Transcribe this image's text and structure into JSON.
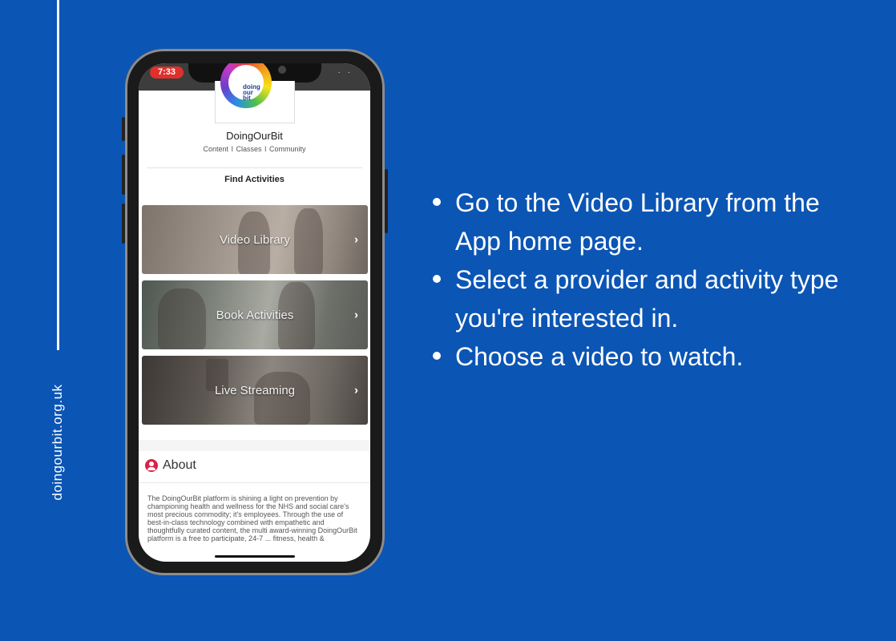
{
  "site_url": "doingourbit.org.uk",
  "phone": {
    "status_time": "7:33",
    "logo_text": [
      "doing",
      "our",
      "bit"
    ],
    "app_name": "DoingOurBit",
    "tagline": "Content  I  Classes  I  Community",
    "section_title": "Find Activities",
    "tiles": [
      {
        "label": "Video Library",
        "chevron": "›"
      },
      {
        "label": "Book Activities",
        "chevron": "›"
      },
      {
        "label": "Live Streaming",
        "chevron": "›"
      }
    ],
    "about": {
      "title": "About",
      "text": "The DoingOurBit platform is shining a light on prevention by championing health and wellness for the NHS and social care's most precious commodity; it's employees. Through the use of best-in-class technology combined with empathetic and thoughtfully curated content, the multi award-winning DoingOurBit platform is a free to participate, 24-7 ... fitness, health &"
    }
  },
  "instructions": [
    "Go to the Video Library from the App home page.",
    "Select a provider and activity type you're interested in.",
    "Choose a video to watch."
  ],
  "colors": {
    "background": "#0b55b5",
    "text": "#ffffff",
    "time_pill": "#e0302b",
    "about_icon": "#d9224a"
  }
}
